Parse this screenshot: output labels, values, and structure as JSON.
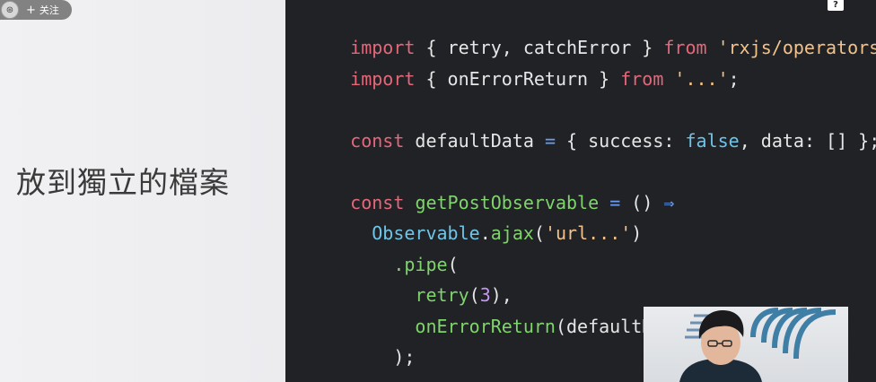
{
  "overlay": {
    "avatar_glyph": "⊛",
    "follow_plus": "+",
    "follow_label": "关注",
    "help_glyph": "?"
  },
  "slide": {
    "title": "放到獨立的檔案"
  },
  "code": {
    "line1": {
      "kw1": "import",
      "t1": " { retry, catchError } ",
      "kw2": "from",
      "t2": " ",
      "str": "'rxjs/operators'",
      "t3": ";"
    },
    "line2": {
      "kw1": "import",
      "t1": " { onErrorReturn } ",
      "kw2": "from",
      "t2": " ",
      "str": "'...'",
      "t3": ";"
    },
    "line3": {
      "kw": "const",
      "t1": " defaultData ",
      "op": "=",
      "t2": " { success: ",
      "bool": "false",
      "t3": ", data: [] };"
    },
    "line4": {
      "kw": "const",
      "t1": " ",
      "fn": "getPostObservable",
      "t2": " ",
      "op1": "=",
      "t3": " () ",
      "op2": "⇒"
    },
    "line5": {
      "indent": "  ",
      "cls": "Observable",
      "t1": ".",
      "fn": "ajax",
      "t2": "(",
      "str": "'url...'",
      "t3": ")"
    },
    "line6": {
      "indent": "    ",
      "fn": ".pipe",
      "t1": "("
    },
    "line7": {
      "indent": "      ",
      "fn": "retry",
      "t1": "(",
      "num": "3",
      "t2": "),"
    },
    "line8": {
      "indent": "      ",
      "fn": "onErrorReturn",
      "t1": "(defaultData)"
    },
    "line9": {
      "indent": "    ",
      "t1": ");"
    }
  },
  "colors": {
    "keyword": "#e5677a",
    "function": "#7fd46b",
    "string": "#f2c28a",
    "number": "#c697f0",
    "class": "#6fc5e8",
    "operator": "#6a9df0",
    "editor_bg": "#202226",
    "slide_bg": "#efeff1"
  }
}
